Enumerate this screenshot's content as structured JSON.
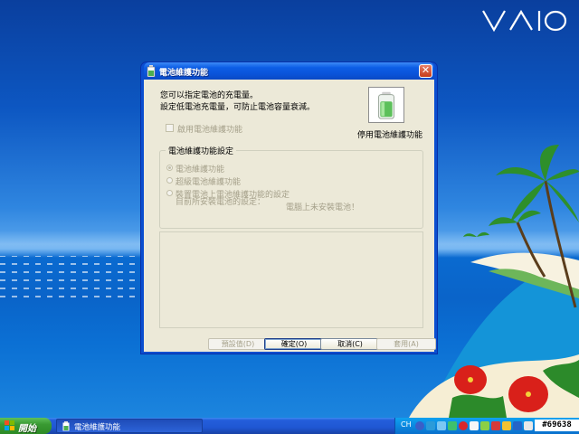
{
  "desktop": {
    "brand_logo": "VAIO",
    "badge": "#69638"
  },
  "window": {
    "title": "電池維護功能",
    "close_symbol": "✕",
    "description_line1": "您可以指定電池的充電量。",
    "description_line2": "設定低電池充電量，可防止電池容量衰減。",
    "battery_icon": "battery-care-icon",
    "disable_caption": "停用電池維護功能",
    "enable_checkbox": {
      "label": "啟用電池維護功能",
      "checked": false,
      "enabled": false
    },
    "group": {
      "title": "電池維護功能設定",
      "options": [
        {
          "label": "電池維護功能",
          "selected": true,
          "enabled": false
        },
        {
          "label": "超級電池維護功能",
          "selected": false,
          "enabled": false
        },
        {
          "label_line1": "裝置電池上電池維護功能的設定",
          "label_line2": "目前所安裝電池的設定：",
          "selected": false,
          "enabled": false
        }
      ],
      "status_text": "電腦上未安裝電池！"
    },
    "buttons": {
      "default": "預設值(D)",
      "ok": "確定(O)",
      "cancel": "取消(C)",
      "apply": "套用(A)"
    }
  },
  "taskbar": {
    "start_label": "開始",
    "task_item_label": "電池維護功能",
    "language": "CH",
    "tray_icons": [
      "help-icon",
      "network-icon",
      "volume-icon",
      "wireless-icon",
      "security-icon",
      "update-icon",
      "bluetooth-icon",
      "battery-icon",
      "display-icon",
      "printer-icon",
      "power-icon",
      "info-icon"
    ]
  }
}
